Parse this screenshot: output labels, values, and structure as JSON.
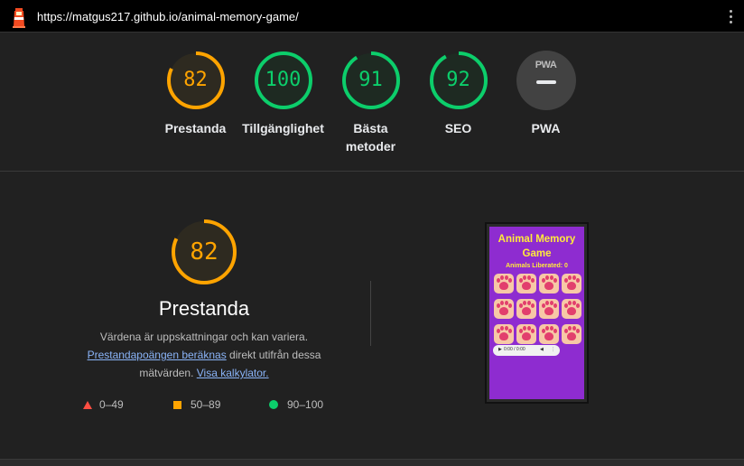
{
  "url": "https://matgus217.github.io/animal-memory-game/",
  "colors": {
    "pass": "#0cce6b",
    "average": "#ffa400",
    "fail": "#ff4e42"
  },
  "categories": [
    {
      "score": "82",
      "score_value": 82,
      "label": "Prestanda",
      "status": "average"
    },
    {
      "score": "100",
      "score_value": 100,
      "label": "Tillgänglighet",
      "status": "pass"
    },
    {
      "score": "91",
      "score_value": 91,
      "label": "Bästa metoder",
      "status": "pass"
    },
    {
      "score": "92",
      "score_value": 92,
      "label": "SEO",
      "status": "pass"
    },
    {
      "label": "PWA",
      "badge_text": "PWA",
      "status": "na"
    }
  ],
  "performance": {
    "score": "82",
    "score_value": 82,
    "title": "Prestanda",
    "desc_line1": "Värdena är uppskattningar och kan variera.",
    "link_calc": "Prestandapoängen beräknas",
    "desc_mid": " direkt utifrån dessa mätvärden. ",
    "link_calculator": "Visa kalkylator.",
    "legend": [
      {
        "range": "0–49",
        "shape": "triangle"
      },
      {
        "range": "50–89",
        "shape": "square"
      },
      {
        "range": "90–100",
        "shape": "circle"
      }
    ]
  },
  "screenshot": {
    "title": "Animal Memory Game",
    "subtitle": "Animals Liberated: 0",
    "player_time": "0:00 / 0:00"
  }
}
